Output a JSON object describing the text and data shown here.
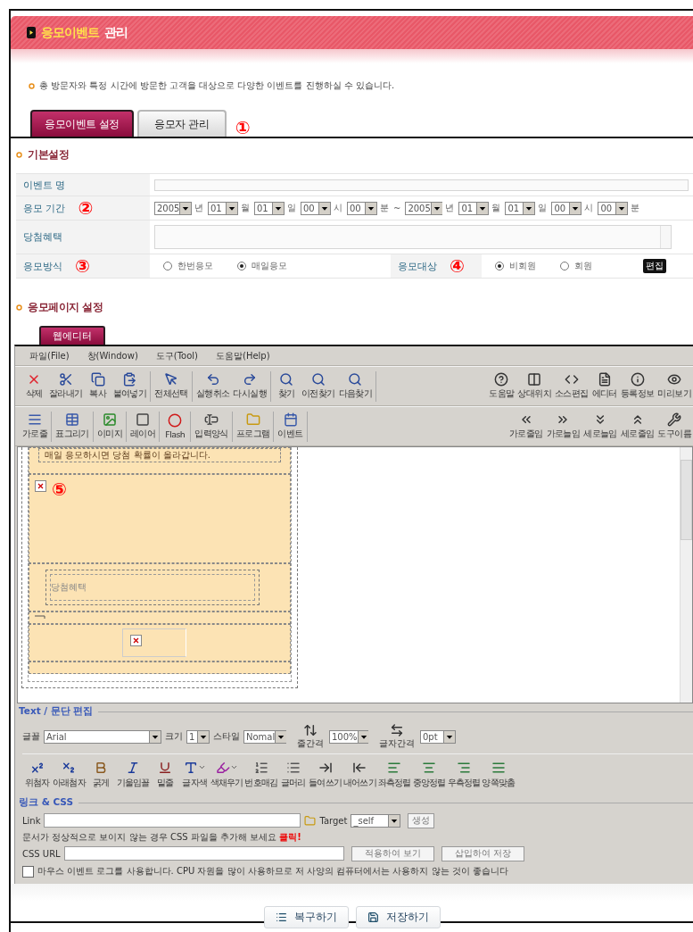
{
  "header": {
    "title_highlight": "응모이벤트",
    "title_rest": "관리"
  },
  "description": "총 방문자와 특정 시간에 방문한 고객을 대상으로 다양한 이벤트를 진행하실 수 있습니다.",
  "tabs": [
    {
      "label": "응모이벤트 설정",
      "selected": true
    },
    {
      "label": "응모자 관리",
      "selected": false
    }
  ],
  "tabs_marker": "①",
  "basic_section": {
    "title": "기본설정",
    "event_name": {
      "label": "이벤트 명"
    },
    "period": {
      "label": "응모 기간",
      "marker": "②",
      "start": [
        {
          "value": "2005",
          "unit": "년"
        },
        {
          "value": "01",
          "unit": "월"
        },
        {
          "value": "01",
          "unit": "일"
        },
        {
          "value": "00",
          "unit": "시"
        },
        {
          "value": "00",
          "unit": "분"
        }
      ],
      "separator": "~",
      "end": [
        {
          "value": "2005",
          "unit": "년"
        },
        {
          "value": "01",
          "unit": "월"
        },
        {
          "value": "01",
          "unit": "일"
        },
        {
          "value": "00",
          "unit": "시"
        },
        {
          "value": "00",
          "unit": "분"
        }
      ]
    },
    "benefit": {
      "label": "당첨혜택"
    },
    "method": {
      "label": "응모방식",
      "marker": "③",
      "options": [
        {
          "label": "한번응모",
          "selected": false
        },
        {
          "label": "매일응모",
          "selected": true
        }
      ]
    },
    "target": {
      "label": "응모대상",
      "marker": "④",
      "options": [
        {
          "label": "비회원",
          "selected": true
        },
        {
          "label": "회원",
          "selected": false
        }
      ],
      "edit_button": "편집"
    }
  },
  "page_section": {
    "title": "응모페이지 설정",
    "editor_tab": {
      "label": "웹에디터",
      "selected": true
    }
  },
  "editor": {
    "menu": [
      "파일(File)",
      "창(Window)",
      "도구(Tool)",
      "도움말(Help)"
    ],
    "toolbar_main": {
      "groups": [
        [
          "삭제",
          "잘라내기",
          "복사",
          "붙여넣기"
        ],
        [
          "전체선택"
        ],
        [
          "실행취소",
          "다시실행"
        ],
        [
          "찾기",
          "이전찾기",
          "다음찾기"
        ]
      ],
      "right": [
        "도움말",
        "상대위치",
        "소스편집",
        "에디터",
        "등록정보",
        "미리보기"
      ]
    },
    "toolbar_insert": {
      "groups": [
        [
          "가로줄"
        ],
        [
          "표그리기"
        ],
        [
          "이미지"
        ],
        [
          "레이어"
        ],
        [
          "Flash"
        ],
        [
          "입력양식"
        ],
        [
          "프로그램"
        ],
        [
          "이벤트"
        ]
      ],
      "right": [
        "가로줄임",
        "가로늘임",
        "세로늘임",
        "세로줄임",
        "도구이름"
      ]
    },
    "canvas": {
      "notice": "매일 응모하시면 당첨 확률이 올라갑니다.",
      "marker": "⑤",
      "benefit_label": "당첨혜택"
    },
    "text_panel": {
      "title": "Text / 문단 편집",
      "font": {
        "label": "글꼴",
        "value": "Arial"
      },
      "size": {
        "label": "크기",
        "value": "1"
      },
      "style": {
        "label": "스타일",
        "value": "Nomal"
      },
      "line_spacing": {
        "label": "줄간격",
        "value": "100%"
      },
      "letter_spacing": {
        "label": "글자간격",
        "value": "0pt"
      },
      "format_buttons": [
        {
          "label": "위첨자",
          "dropdown": false
        },
        {
          "label": "아래첨자",
          "dropdown": false
        },
        {
          "label": "굵게",
          "dropdown": false
        },
        {
          "label": "기울임꼴",
          "dropdown": false
        },
        {
          "label": "밑줄",
          "dropdown": false
        },
        {
          "label": "글자색",
          "dropdown": true
        },
        {
          "label": "색채우기",
          "dropdown": true
        },
        {
          "label": "번호매김",
          "dropdown": false
        },
        {
          "label": "글머리",
          "dropdown": false
        },
        {
          "label": "들여쓰기",
          "dropdown": false
        },
        {
          "label": "내어쓰기",
          "dropdown": false
        },
        {
          "label": "좌측정렬",
          "dropdown": false
        },
        {
          "label": "중앙정렬",
          "dropdown": false
        },
        {
          "label": "우측정렬",
          "dropdown": false
        },
        {
          "label": "양쪽맞춤",
          "dropdown": false
        }
      ]
    },
    "link_panel": {
      "title": "링크 & CSS",
      "link": {
        "label": "Link"
      },
      "target": {
        "label": "Target",
        "value": "_self"
      },
      "create_button": "생성",
      "css_notice": "문서가 정상적으로 보이지 않는 경우 CSS 파일을 추가해 보세요",
      "css_notice_link": "클릭!",
      "css_url": {
        "label": "CSS URL"
      },
      "apply_button": "적용하여 보기",
      "insert_button": "삽입하여 저장",
      "mouse_log": {
        "label": "마우스 이벤트 로그를 사용합니다. CPU 자원을 많이 사용하므로 저 사양의 컴퓨터에서는 사용하지 않는 것이 좋습니다",
        "checked": false
      }
    }
  },
  "footer_buttons": [
    "복구하기",
    "저장하기"
  ]
}
